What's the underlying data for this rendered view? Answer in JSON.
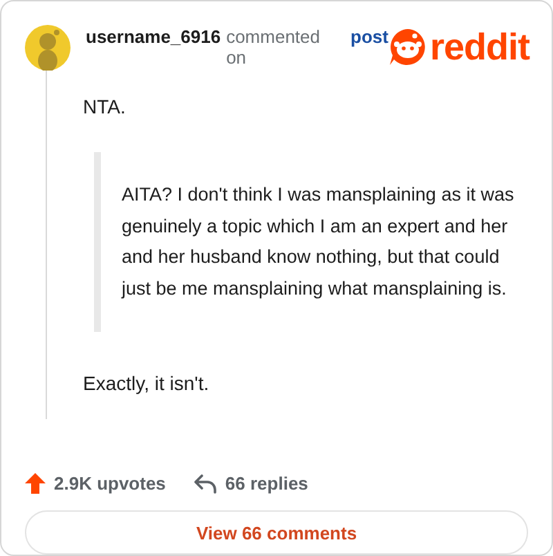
{
  "header": {
    "username": "username_6916",
    "action": "commented on",
    "link": "post",
    "brand": "reddit"
  },
  "comment": {
    "paragraphs": [
      {
        "kind": "text",
        "text": "NTA."
      },
      {
        "kind": "quote",
        "text": "AITA? I don't think I was mansplaining as it was genuinely a topic which I am an expert and her and her husband know nothing, but that could just be me mansplaining what mansplaining is."
      },
      {
        "kind": "text",
        "text": "Exactly, it isn't."
      }
    ]
  },
  "actions": {
    "upvotes": "2.9K upvotes",
    "replies": "66 replies"
  },
  "button": "View 66 comments"
}
